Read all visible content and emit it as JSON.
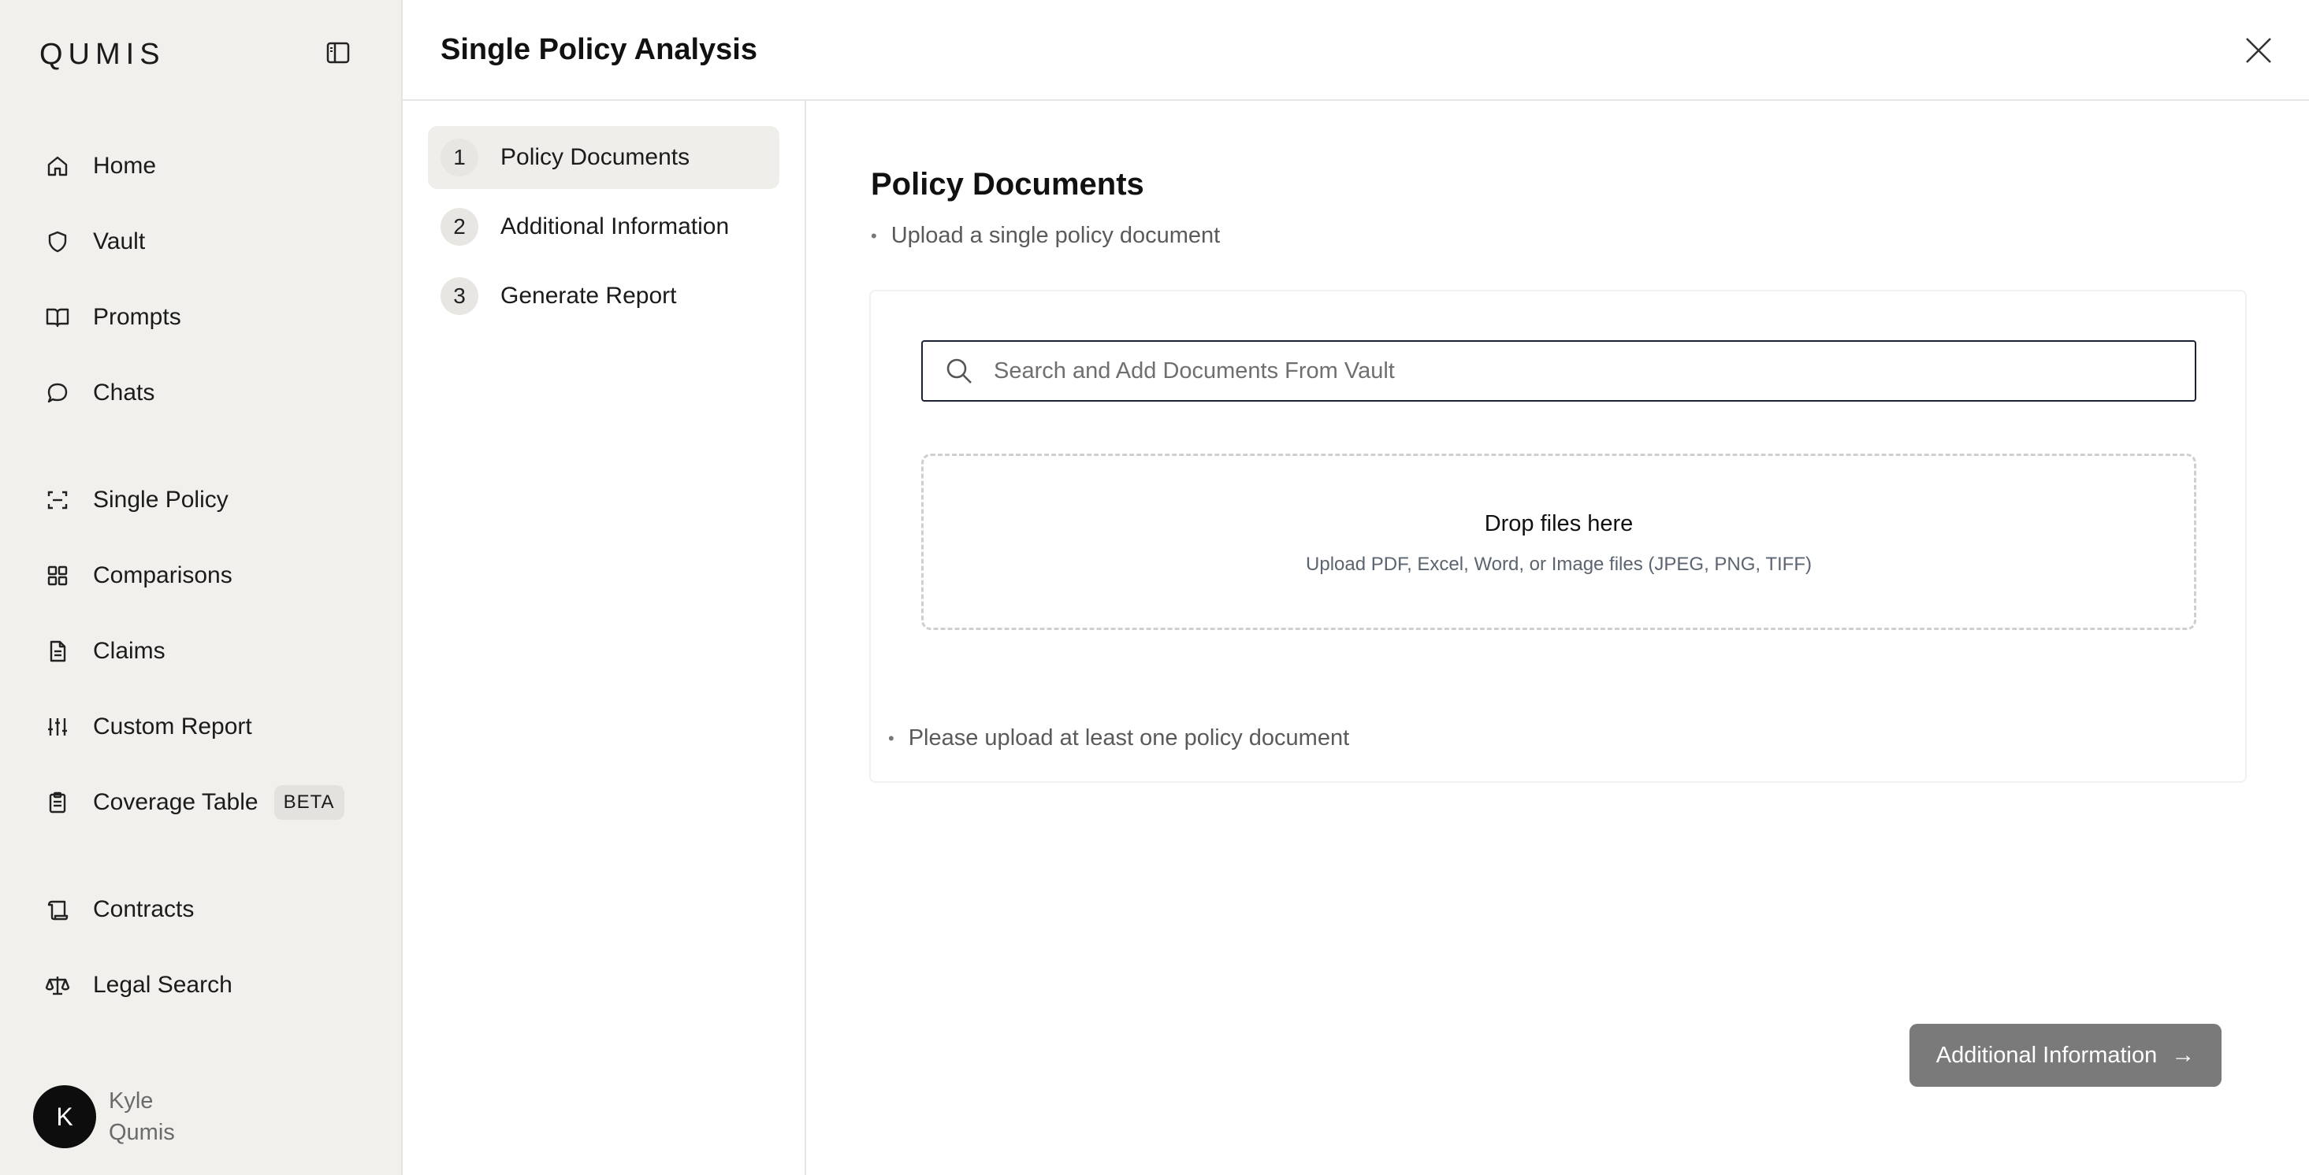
{
  "sidebar": {
    "logo": "QUMIS",
    "collapse_icon": "sidebar-toggle-icon",
    "items": [
      {
        "label": "Home",
        "icon": "home-icon"
      },
      {
        "label": "Vault",
        "icon": "shield-icon"
      },
      {
        "label": "Prompts",
        "icon": "book-icon"
      },
      {
        "label": "Chats",
        "icon": "chat-icon"
      },
      {
        "label": "Single Policy",
        "icon": "scan-icon"
      },
      {
        "label": "Comparisons",
        "icon": "grid-icon"
      },
      {
        "label": "Claims",
        "icon": "document-icon"
      },
      {
        "label": "Custom Report",
        "icon": "sliders-icon"
      },
      {
        "label": "Coverage Table",
        "icon": "clipboard-icon",
        "badge": "BETA"
      },
      {
        "label": "Contracts",
        "icon": "scroll-icon"
      },
      {
        "label": "Legal Search",
        "icon": "scale-icon"
      }
    ],
    "user": {
      "initial": "K",
      "first_name": "Kyle",
      "last_name": "Qumis"
    }
  },
  "header": {
    "title": "Single Policy Analysis",
    "close_icon": "close-icon"
  },
  "steps": [
    {
      "number": "1",
      "label": "Policy Documents",
      "active": true
    },
    {
      "number": "2",
      "label": "Additional Information",
      "active": false
    },
    {
      "number": "3",
      "label": "Generate Report",
      "active": false
    }
  ],
  "main": {
    "section_title": "Policy Documents",
    "instruction": "Upload a single policy document",
    "search": {
      "placeholder": "Search and Add Documents From Vault",
      "value": ""
    },
    "dropzone": {
      "title": "Drop files here",
      "subtitle": "Upload PDF, Excel, Word, or Image files (JPEG, PNG, TIFF)"
    },
    "validation": "Please upload at least one policy document",
    "next_button": {
      "label": "Additional Information",
      "arrow": "→"
    }
  },
  "colors": {
    "sidebar_bg": "#f1f0ed",
    "active_step_bg": "#efeeeb",
    "button_bg": "#7a7a7a",
    "search_border": "#1c2233"
  }
}
